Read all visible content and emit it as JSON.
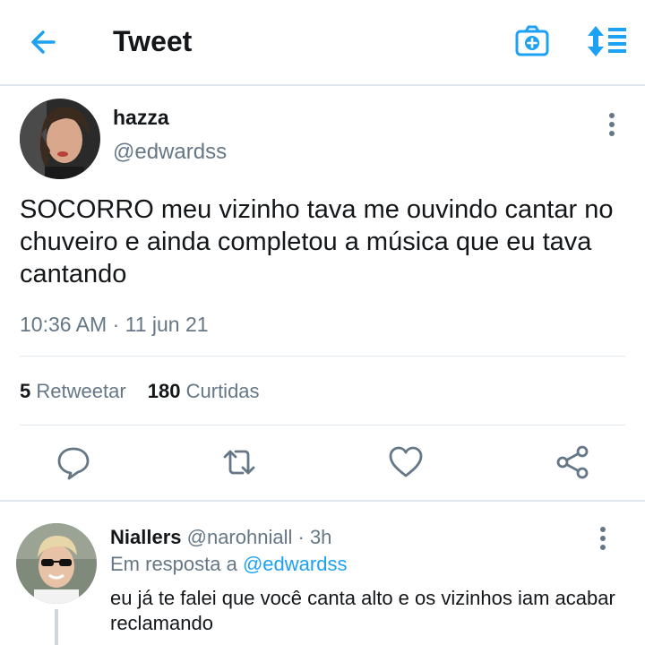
{
  "header": {
    "title": "Tweet"
  },
  "tweet": {
    "display_name": "hazza",
    "handle": "@edwardss",
    "text": "SOCORRO meu vizinho tava me ouvindo cantar no chuveiro e ainda completou a música que eu tava cantando",
    "timestamp": "10:36 AM · 11 jun 21",
    "retweets_count": "5",
    "retweets_label": "Retweetar",
    "likes_count": "180",
    "likes_label": "Curtidas"
  },
  "reply": {
    "display_name": "Niallers",
    "handle": "@narohniall",
    "separator": "·",
    "time": "3h",
    "replying_prefix": "Em resposta a",
    "replying_to": "@edwardss",
    "text": "eu já te falei que você canta alto e os vizinhos iam acabar reclamando"
  },
  "icons": {
    "back": "arrow-left-icon",
    "camera": "camera-plus-icon",
    "sort": "sort-list-icon",
    "more": "more-vertical-icon",
    "reply": "comment-icon",
    "retweet": "retweet-icon",
    "like": "heart-icon",
    "share": "share-icon"
  },
  "colors": {
    "accent": "#1da1f2",
    "secondary_text": "#657786",
    "divider": "#e1e8ed"
  }
}
